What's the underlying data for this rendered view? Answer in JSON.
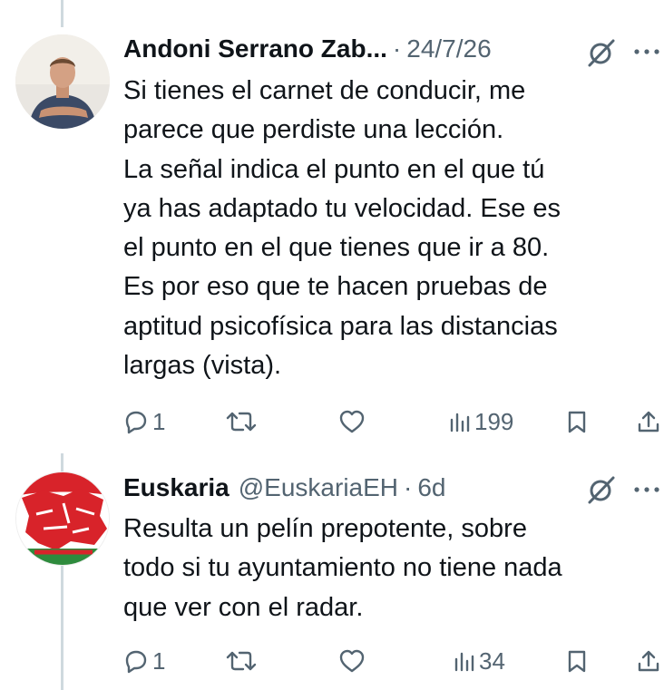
{
  "tweets": [
    {
      "author_name": "Andoni Serrano Zab...",
      "separator": "·",
      "date": "24/7/26",
      "body_lines": [
        "Si tienes el carnet de conducir, me",
        "parece que perdiste una lección.",
        "La señal indica el punto en el que tú",
        "ya has adaptado tu velocidad. Ese es",
        "el punto en el que tienes que ir a 80.",
        "Es por eso que te hacen pruebas de",
        "aptitud psicofísica para las distancias",
        "largas (vista)."
      ],
      "replies": "1",
      "views": "199",
      "icons": [
        "avatar",
        "grok-icon",
        "more-icon",
        "reply-icon",
        "retweet-icon",
        "like-icon",
        "views-icon",
        "bookmark-icon",
        "share-icon"
      ]
    },
    {
      "author_name": "Euskaria",
      "handle": "@EuskariaEH",
      "separator": "·",
      "date": "6d",
      "body_lines": [
        "Resulta un pelín prepotente, sobre",
        "todo si tu ayuntamiento no tiene nada",
        "que ver con el radar."
      ],
      "replies": "1",
      "views": "34",
      "icons": [
        "avatar",
        "grok-icon",
        "more-icon",
        "reply-icon",
        "retweet-icon",
        "like-icon",
        "views-icon",
        "bookmark-icon",
        "share-icon"
      ]
    }
  ],
  "colors": {
    "text": "#0f1419",
    "secondary": "#536471",
    "thread_line": "#cfd9de",
    "euskaria_red": "#d8232a",
    "euskaria_green": "#2e8b3d"
  }
}
